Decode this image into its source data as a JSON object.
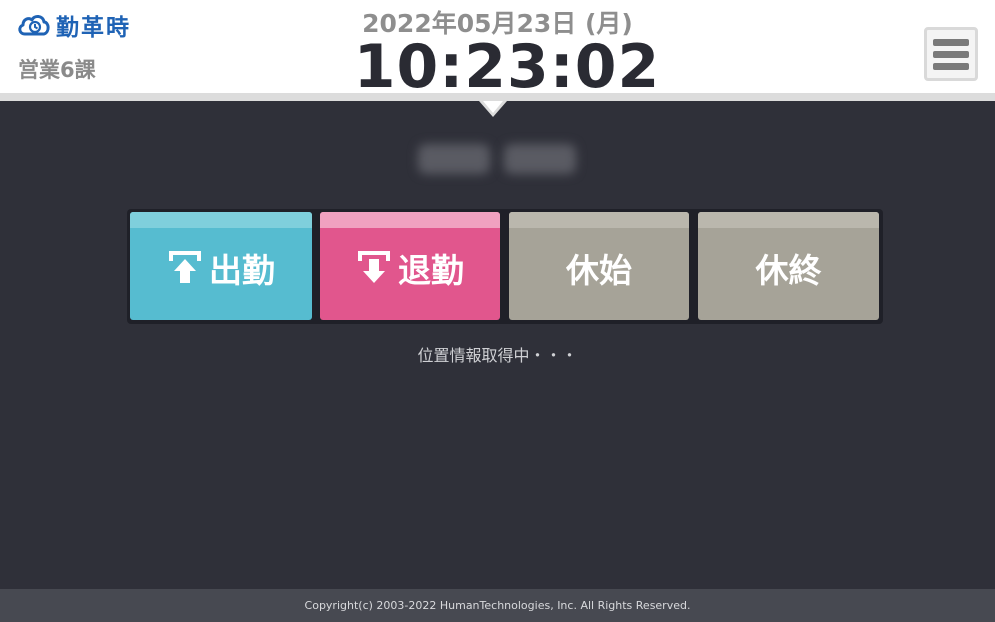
{
  "app": {
    "logo_text": "勤革時",
    "logo_icon": "cloud-clock-icon"
  },
  "header": {
    "department": "営業6課",
    "date": "2022年05月23日 (月)",
    "time": "10:23:02",
    "menu_icon": "hamburger-menu-icon"
  },
  "buttons": {
    "clock_in": {
      "label": "出勤",
      "icon": "arrow-up-icon",
      "color": "#56bcd0"
    },
    "clock_out": {
      "label": "退勤",
      "icon": "arrow-down-icon",
      "color": "#e1568d"
    },
    "break_start": {
      "label": "休始",
      "color": "#a6a398"
    },
    "break_end": {
      "label": "休終",
      "color": "#a6a398"
    }
  },
  "status": {
    "message": "位置情報取得中・・・"
  },
  "footer": {
    "copyright": "Copyright(c) 2003-2022 HumanTechnologies, Inc. All Rights Reserved."
  },
  "colors": {
    "background": "#2f3039",
    "header_bg": "#ffffff",
    "brand_blue": "#1f63b5"
  }
}
